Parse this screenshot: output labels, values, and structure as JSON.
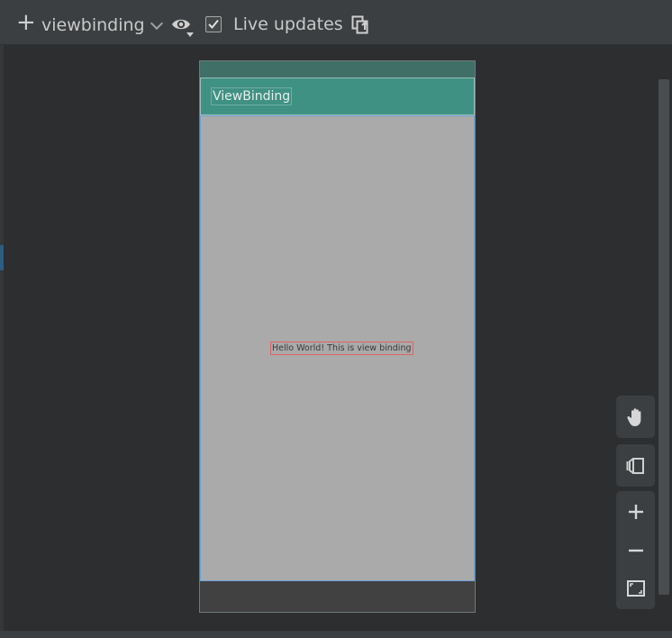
{
  "toolbar": {
    "add_icon": "plus-icon",
    "module_label": "viewbinding",
    "module_chevron_icon": "chevron-down-icon",
    "visibility_icon": "eye-icon",
    "live_updates_label": "Live updates",
    "live_updates_checked": true,
    "refresh_icon": "copy-refresh-icon"
  },
  "device": {
    "app_bar_title": "ViewBinding",
    "content_text": "Hello World! This is view binding"
  },
  "controls": {
    "pan_icon": "hand-icon",
    "blueprint_icon": "blueprint-toggle-icon",
    "zoom_in_icon": "plus-icon",
    "zoom_out_icon": "minus-icon",
    "fit_icon": "fit-screen-icon"
  },
  "colors": {
    "app_bar": "#3f9183",
    "status_bar": "#3f6f66",
    "content_bg": "#aaaaaa",
    "selection_outline": "#e06262",
    "layout_outline": "#6ea3d8"
  }
}
